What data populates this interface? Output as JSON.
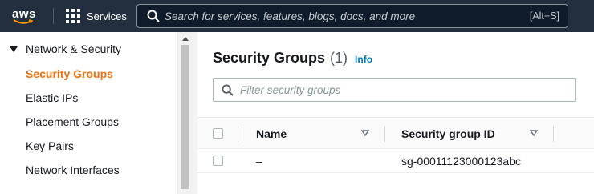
{
  "topbar": {
    "logo_text": "aws",
    "services_label": "Services",
    "search_placeholder": "Search for services, features, blogs, docs, and more",
    "search_shortcut": "[Alt+S]"
  },
  "sidebar": {
    "section_label": "Network & Security",
    "items": [
      {
        "label": "Security Groups",
        "active": true
      },
      {
        "label": "Elastic IPs",
        "active": false
      },
      {
        "label": "Placement Groups",
        "active": false
      },
      {
        "label": "Key Pairs",
        "active": false
      },
      {
        "label": "Network Interfaces",
        "active": false
      }
    ]
  },
  "main": {
    "title": "Security Groups",
    "count": "(1)",
    "info_label": "Info",
    "filter_placeholder": "Filter security groups",
    "columns": [
      "Name",
      "Security group ID"
    ],
    "rows": [
      {
        "name": "–",
        "group_id": "sg-00011123000123abc"
      }
    ]
  },
  "colors": {
    "nav_bg": "#232f3e",
    "active_link": "#ec7211",
    "info_link": "#0073bb",
    "logo_smile": "#ff9900"
  },
  "icons": [
    "grid-icon",
    "search-icon",
    "caret-down-icon",
    "sort-icon"
  ]
}
